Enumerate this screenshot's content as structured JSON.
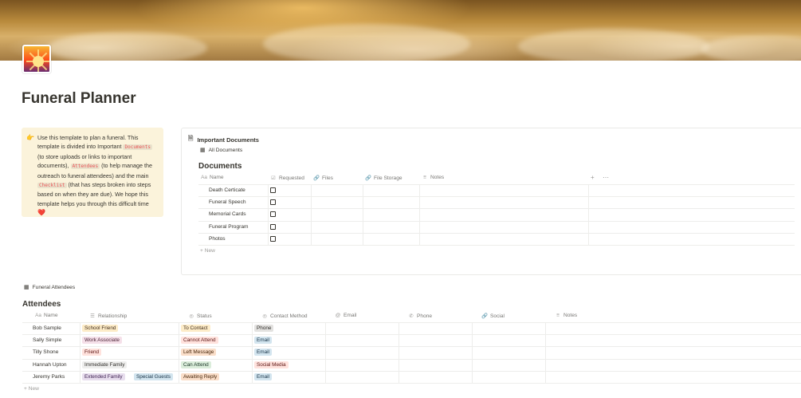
{
  "page": {
    "title": "Funeral Planner",
    "colors": {
      "text": "#37352f",
      "muted": "#787774",
      "callout_bg": "#fbf3db",
      "code_red": "#eb5757",
      "heart": "#e03e3e"
    }
  },
  "callout": {
    "icon": "pointing-hand-icon",
    "text_1": "Use this template to plan a funeral. This template is divided into Important",
    "code_documents": "Documents",
    "text_2": "(to store uploads or links to important documents),",
    "code_attendees": "Attendees",
    "text_3": "(to help manage the outreach to funeral attendees) and the main",
    "code_checklist": "Checklist",
    "text_4": "(that has steps broken into steps based on when they are due). We hope this template helps you through this difficult time",
    "heart": "❤️"
  },
  "documents": {
    "page_link": "Important Documents",
    "view_tab": "All Documents",
    "title": "Documents",
    "columns": [
      "Name",
      "Requested",
      "Files",
      "File Storage",
      "Notes"
    ],
    "rows": [
      {
        "name": "Death Certicate",
        "requested": false
      },
      {
        "name": "Funeral Speech",
        "requested": false
      },
      {
        "name": "Memorial Cards",
        "requested": false
      },
      {
        "name": "Funeral Program",
        "requested": false
      },
      {
        "name": "Photos",
        "requested": false
      }
    ],
    "new_label": "New",
    "add_symbol": "+",
    "more_symbol": "⋯"
  },
  "attendees": {
    "view_tab": "Funeral Attendees",
    "title": "Attendees",
    "columns": [
      "Name",
      "Relationship",
      "Status",
      "Contact Method",
      "Email",
      "Phone",
      "Social",
      "Notes"
    ],
    "rows": [
      {
        "name": "Bob Sample",
        "relationship": [
          "School Friend"
        ],
        "status": "To Contact",
        "contact": "Phone"
      },
      {
        "name": "Sally Simple",
        "relationship": [
          "Work Associate"
        ],
        "status": "Cannot Attend",
        "contact": "Email"
      },
      {
        "name": "Tilly Shone",
        "relationship": [
          "Friend"
        ],
        "status": "Left Message",
        "contact": "Email"
      },
      {
        "name": "Hannah Upton",
        "relationship": [
          "Immediate Family"
        ],
        "status": "Can Attend",
        "contact": "Social Media"
      },
      {
        "name": "Jeremy Parks",
        "relationship": [
          "Extended Family",
          "Special Guests"
        ],
        "status": "Awaiting Reply",
        "contact": "Email"
      }
    ],
    "new_label": "New"
  }
}
